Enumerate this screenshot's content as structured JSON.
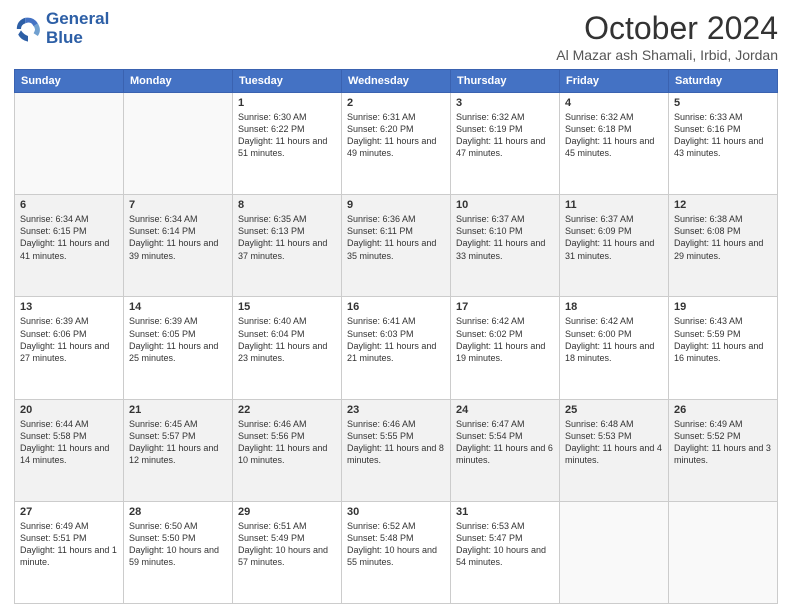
{
  "header": {
    "logo_line1": "General",
    "logo_line2": "Blue",
    "month": "October 2024",
    "location": "Al Mazar ash Shamali, Irbid, Jordan"
  },
  "weekdays": [
    "Sunday",
    "Monday",
    "Tuesday",
    "Wednesday",
    "Thursday",
    "Friday",
    "Saturday"
  ],
  "weeks": [
    [
      {
        "day": "",
        "info": ""
      },
      {
        "day": "",
        "info": ""
      },
      {
        "day": "1",
        "info": "Sunrise: 6:30 AM\nSunset: 6:22 PM\nDaylight: 11 hours and 51 minutes."
      },
      {
        "day": "2",
        "info": "Sunrise: 6:31 AM\nSunset: 6:20 PM\nDaylight: 11 hours and 49 minutes."
      },
      {
        "day": "3",
        "info": "Sunrise: 6:32 AM\nSunset: 6:19 PM\nDaylight: 11 hours and 47 minutes."
      },
      {
        "day": "4",
        "info": "Sunrise: 6:32 AM\nSunset: 6:18 PM\nDaylight: 11 hours and 45 minutes."
      },
      {
        "day": "5",
        "info": "Sunrise: 6:33 AM\nSunset: 6:16 PM\nDaylight: 11 hours and 43 minutes."
      }
    ],
    [
      {
        "day": "6",
        "info": "Sunrise: 6:34 AM\nSunset: 6:15 PM\nDaylight: 11 hours and 41 minutes."
      },
      {
        "day": "7",
        "info": "Sunrise: 6:34 AM\nSunset: 6:14 PM\nDaylight: 11 hours and 39 minutes."
      },
      {
        "day": "8",
        "info": "Sunrise: 6:35 AM\nSunset: 6:13 PM\nDaylight: 11 hours and 37 minutes."
      },
      {
        "day": "9",
        "info": "Sunrise: 6:36 AM\nSunset: 6:11 PM\nDaylight: 11 hours and 35 minutes."
      },
      {
        "day": "10",
        "info": "Sunrise: 6:37 AM\nSunset: 6:10 PM\nDaylight: 11 hours and 33 minutes."
      },
      {
        "day": "11",
        "info": "Sunrise: 6:37 AM\nSunset: 6:09 PM\nDaylight: 11 hours and 31 minutes."
      },
      {
        "day": "12",
        "info": "Sunrise: 6:38 AM\nSunset: 6:08 PM\nDaylight: 11 hours and 29 minutes."
      }
    ],
    [
      {
        "day": "13",
        "info": "Sunrise: 6:39 AM\nSunset: 6:06 PM\nDaylight: 11 hours and 27 minutes."
      },
      {
        "day": "14",
        "info": "Sunrise: 6:39 AM\nSunset: 6:05 PM\nDaylight: 11 hours and 25 minutes."
      },
      {
        "day": "15",
        "info": "Sunrise: 6:40 AM\nSunset: 6:04 PM\nDaylight: 11 hours and 23 minutes."
      },
      {
        "day": "16",
        "info": "Sunrise: 6:41 AM\nSunset: 6:03 PM\nDaylight: 11 hours and 21 minutes."
      },
      {
        "day": "17",
        "info": "Sunrise: 6:42 AM\nSunset: 6:02 PM\nDaylight: 11 hours and 19 minutes."
      },
      {
        "day": "18",
        "info": "Sunrise: 6:42 AM\nSunset: 6:00 PM\nDaylight: 11 hours and 18 minutes."
      },
      {
        "day": "19",
        "info": "Sunrise: 6:43 AM\nSunset: 5:59 PM\nDaylight: 11 hours and 16 minutes."
      }
    ],
    [
      {
        "day": "20",
        "info": "Sunrise: 6:44 AM\nSunset: 5:58 PM\nDaylight: 11 hours and 14 minutes."
      },
      {
        "day": "21",
        "info": "Sunrise: 6:45 AM\nSunset: 5:57 PM\nDaylight: 11 hours and 12 minutes."
      },
      {
        "day": "22",
        "info": "Sunrise: 6:46 AM\nSunset: 5:56 PM\nDaylight: 11 hours and 10 minutes."
      },
      {
        "day": "23",
        "info": "Sunrise: 6:46 AM\nSunset: 5:55 PM\nDaylight: 11 hours and 8 minutes."
      },
      {
        "day": "24",
        "info": "Sunrise: 6:47 AM\nSunset: 5:54 PM\nDaylight: 11 hours and 6 minutes."
      },
      {
        "day": "25",
        "info": "Sunrise: 6:48 AM\nSunset: 5:53 PM\nDaylight: 11 hours and 4 minutes."
      },
      {
        "day": "26",
        "info": "Sunrise: 6:49 AM\nSunset: 5:52 PM\nDaylight: 11 hours and 3 minutes."
      }
    ],
    [
      {
        "day": "27",
        "info": "Sunrise: 6:49 AM\nSunset: 5:51 PM\nDaylight: 11 hours and 1 minute."
      },
      {
        "day": "28",
        "info": "Sunrise: 6:50 AM\nSunset: 5:50 PM\nDaylight: 10 hours and 59 minutes."
      },
      {
        "day": "29",
        "info": "Sunrise: 6:51 AM\nSunset: 5:49 PM\nDaylight: 10 hours and 57 minutes."
      },
      {
        "day": "30",
        "info": "Sunrise: 6:52 AM\nSunset: 5:48 PM\nDaylight: 10 hours and 55 minutes."
      },
      {
        "day": "31",
        "info": "Sunrise: 6:53 AM\nSunset: 5:47 PM\nDaylight: 10 hours and 54 minutes."
      },
      {
        "day": "",
        "info": ""
      },
      {
        "day": "",
        "info": ""
      }
    ]
  ]
}
